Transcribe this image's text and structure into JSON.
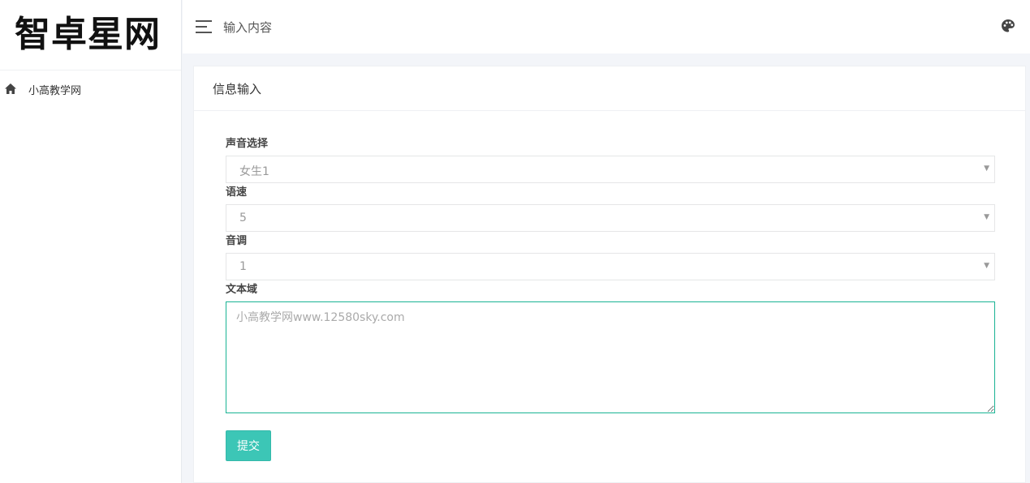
{
  "brand": {
    "title": "智卓星网"
  },
  "sidebar": {
    "items": [
      {
        "label": "小高教学网",
        "icon": "home-icon"
      }
    ]
  },
  "topbar": {
    "title": "输入内容",
    "icon": "palette-icon"
  },
  "card": {
    "title": "信息输入"
  },
  "form": {
    "voice": {
      "label": "声音选择",
      "value": "女生1"
    },
    "speed": {
      "label": "语速",
      "value": "5"
    },
    "pitch": {
      "label": "音调",
      "value": "1"
    },
    "text": {
      "label": "文本域",
      "placeholder": "小高教学网www.12580sky.com"
    },
    "submit_label": "提交"
  },
  "colors": {
    "accent": "#1ab394",
    "button": "#3cc6b6"
  }
}
